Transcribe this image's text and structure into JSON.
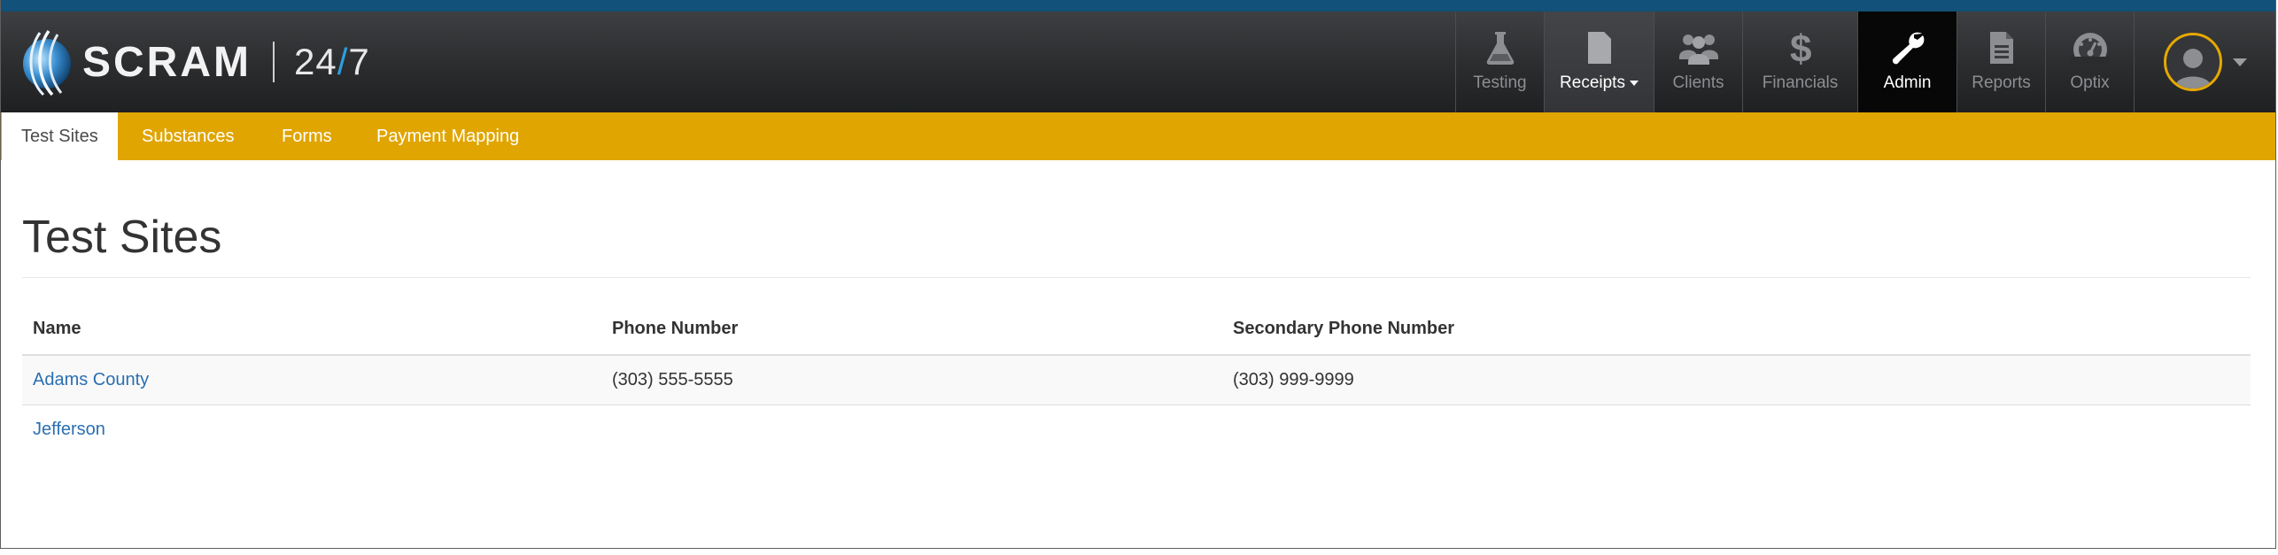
{
  "brand": {
    "name": "SCRAM",
    "suffix_a": "24",
    "suffix_slash": "/",
    "suffix_b": "7"
  },
  "nav": {
    "testing": {
      "label": "Testing",
      "icon": "flask-icon"
    },
    "receipts": {
      "label": "Receipts",
      "icon": "receipt-dollar-icon"
    },
    "clients": {
      "label": "Clients",
      "icon": "users-icon"
    },
    "financials": {
      "label": "Financials",
      "icon": "dollar-icon"
    },
    "admin": {
      "label": "Admin",
      "icon": "wrench-icon"
    },
    "reports": {
      "label": "Reports",
      "icon": "document-icon"
    },
    "optix": {
      "label": "Optix",
      "icon": "dashboard-gauge-icon"
    },
    "user": {
      "icon": "user-avatar-icon"
    }
  },
  "subnav": {
    "tabs": [
      "Test Sites",
      "Substances",
      "Forms",
      "Payment Mapping"
    ],
    "active": "Test Sites"
  },
  "page": {
    "title": "Test Sites"
  },
  "table": {
    "headers": [
      "Name",
      "Phone Number",
      "Secondary Phone Number"
    ],
    "rows": [
      {
        "name": "Adams County",
        "phone": "(303) 555-5555",
        "secondary": "(303) 999-9999"
      },
      {
        "name": "Jefferson",
        "phone": "",
        "secondary": ""
      }
    ]
  },
  "colors": {
    "accent": "#e0a500",
    "navbar": "#2b2c2e",
    "link": "#2a6fb0",
    "topline": "#125179"
  }
}
